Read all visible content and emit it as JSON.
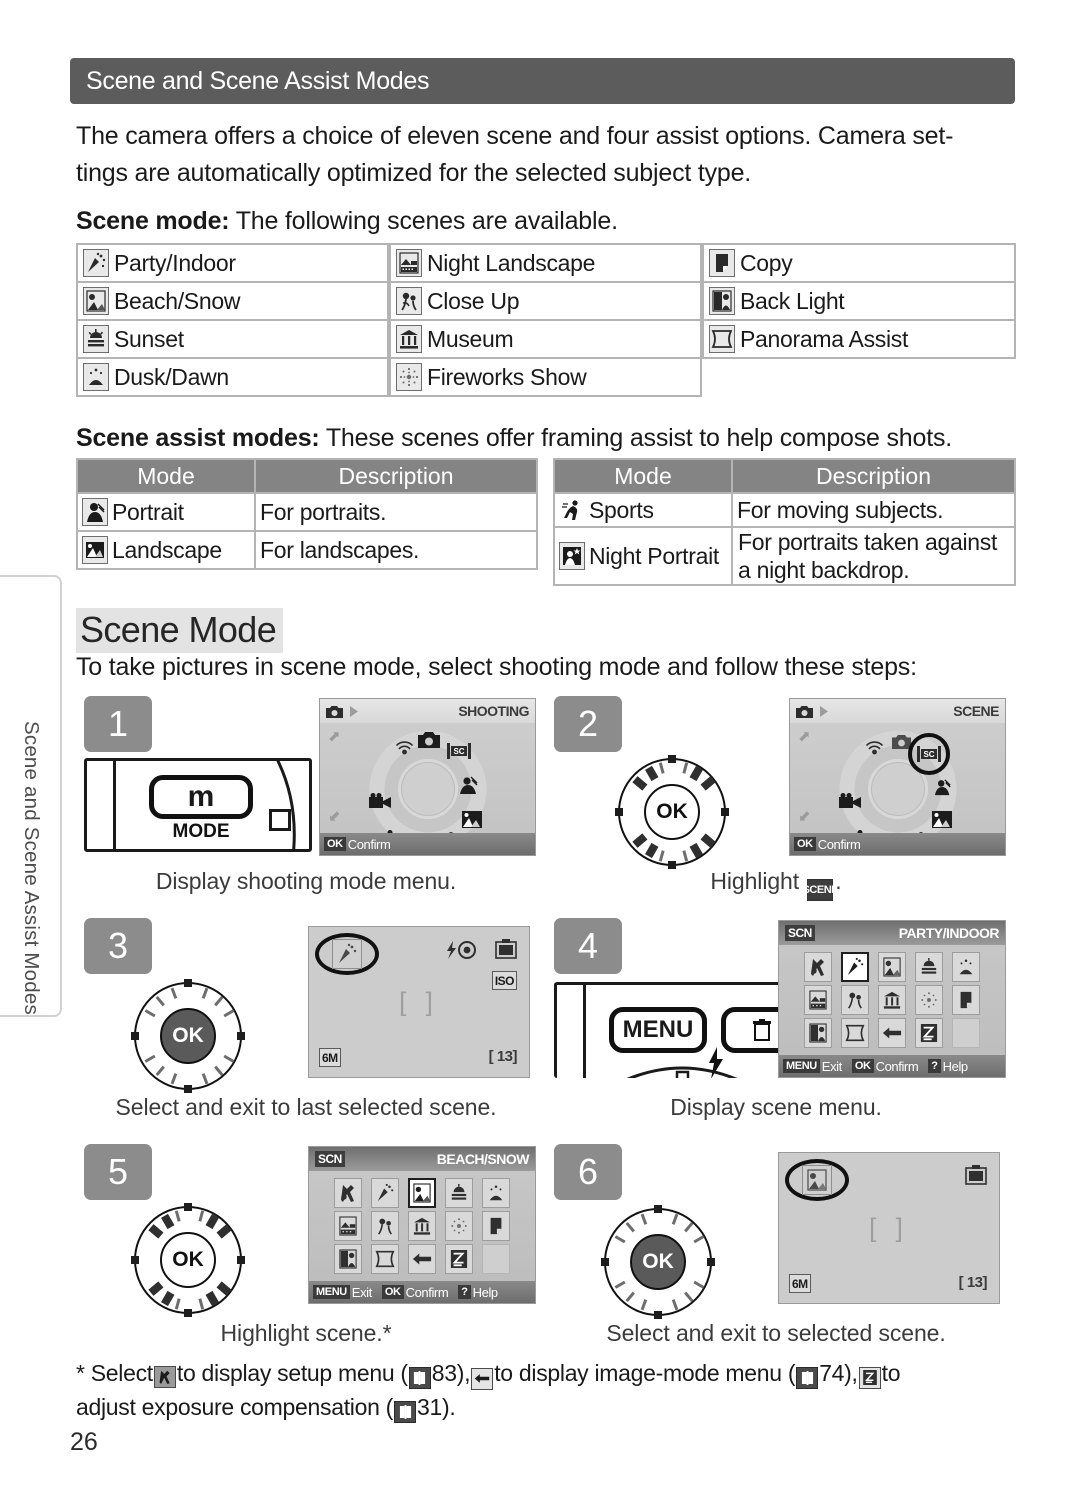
{
  "page": {
    "number": "26",
    "side_tab_label": "Scene and Scene Assist Modes"
  },
  "section": {
    "title": "Scene and Scene Assist Modes",
    "intro_line1": "The camera offers a choice of eleven scene and four assist options.  Camera set-",
    "intro_line2": "tings are automatically optimized for the selected subject type.",
    "scene_mode_lead_bold": "Scene mode:",
    "scene_mode_lead_rest": " The following scenes are available.",
    "assist_lead_bold": "Scene assist modes:",
    "assist_lead_rest": " These scenes offer framing assist to help compose shots."
  },
  "scene_list": {
    "column1": [
      {
        "icon": "party-indoor-icon",
        "label": "Party/Indoor"
      },
      {
        "icon": "beach-snow-icon",
        "label": "Beach/Snow"
      },
      {
        "icon": "sunset-icon",
        "label": "Sunset"
      },
      {
        "icon": "dusk-dawn-icon",
        "label": "Dusk/Dawn"
      }
    ],
    "column2": [
      {
        "icon": "night-landscape-icon",
        "label": "Night Landscape"
      },
      {
        "icon": "close-up-icon",
        "label": "Close Up"
      },
      {
        "icon": "museum-icon",
        "label": "Museum"
      },
      {
        "icon": "fireworks-show-icon",
        "label": "Fireworks Show"
      }
    ],
    "column3": [
      {
        "icon": "copy-icon",
        "label": "Copy"
      },
      {
        "icon": "back-light-icon",
        "label": "Back Light"
      },
      {
        "icon": "panorama-assist-icon",
        "label": "Panorama Assist"
      }
    ]
  },
  "assist_table_left": {
    "headers": {
      "mode": "Mode",
      "description": "Description"
    },
    "rows": [
      {
        "icon": "portrait-icon",
        "mode": "Portrait",
        "description": "For portraits."
      },
      {
        "icon": "landscape-icon",
        "mode": "Landscape",
        "description": "For landscapes."
      }
    ]
  },
  "assist_table_right": {
    "headers": {
      "mode": "Mode",
      "description": "Description"
    },
    "rows": [
      {
        "icon": "sports-icon",
        "mode": "Sports",
        "description": "For moving subjects."
      },
      {
        "icon": "night-portrait-icon",
        "mode": "Night Portrait",
        "description_line1": "For portraits taken against",
        "description_line2": "a night backdrop."
      }
    ]
  },
  "scene_mode_section": {
    "heading": "Scene Mode",
    "lead": "To take pictures in scene mode, select shooting mode and follow these steps:"
  },
  "steps": [
    {
      "number": "1",
      "caption": "Display shooting mode menu.",
      "camera_button_label": "m",
      "camera_button_sublabel": "MODE",
      "lcd": {
        "mode_title": "SHOOTING",
        "confirm_key": "OK",
        "confirm_label": "Confirm",
        "dial_items": [
          "wireless-icon",
          "camera-icon",
          "scene-icon",
          "movie-icon",
          "portrait-assist-icon",
          "voice-icon",
          "landscape-assist-icon",
          "night-portrait-icon",
          "sports-icon"
        ],
        "selected": "camera-icon"
      }
    },
    {
      "number": "2",
      "caption_prefix": "Highlight ",
      "caption_icon": "SCENE",
      "caption_suffix": ".",
      "selector_label": "OK",
      "lcd": {
        "mode_title": "SCENE",
        "confirm_key": "OK",
        "confirm_label": "Confirm",
        "selected": "scene-icon"
      }
    },
    {
      "number": "3",
      "caption": "Select and exit to last selected scene.",
      "selector_label": "OK",
      "lcd": {
        "highlighted_icon": "party-indoor-icon",
        "flash_icon": "red-eye-flash-icon",
        "battery_icon": "battery-icon",
        "iso_label": "ISO",
        "image_size": "6M",
        "shots_remaining": "13"
      }
    },
    {
      "number": "4",
      "caption": "Display scene menu.",
      "camera_button_label": "MENU",
      "lcd": {
        "badge": "SCN",
        "mode_title": "PARTY/INDOOR",
        "exit_key": "MENU",
        "exit_label": "Exit",
        "confirm_key": "OK",
        "confirm_label": "Confirm",
        "help_key": "?",
        "help_label": "Help",
        "grid": [
          "setup-icon",
          "party-indoor-icon",
          "beach-snow-icon",
          "sunset-icon",
          "dusk-dawn-icon",
          "night-landscape-icon",
          "close-up-icon",
          "museum-icon",
          "fireworks-show-icon",
          "copy-icon",
          "back-light-icon",
          "panorama-assist-icon",
          "image-mode-icon",
          "exposure-comp-icon",
          "blank"
        ],
        "selected_index": 1
      }
    },
    {
      "number": "5",
      "caption": "Highlight scene.*",
      "selector_label": "OK",
      "lcd": {
        "badge": "SCN",
        "mode_title": "BEACH/SNOW",
        "exit_key": "MENU",
        "exit_label": "Exit",
        "confirm_key": "OK",
        "confirm_label": "Confirm",
        "help_key": "?",
        "help_label": "Help",
        "grid": [
          "setup-icon",
          "party-indoor-icon",
          "beach-snow-icon",
          "sunset-icon",
          "dusk-dawn-icon",
          "night-landscape-icon",
          "close-up-icon",
          "museum-icon",
          "fireworks-show-icon",
          "copy-icon",
          "back-light-icon",
          "panorama-assist-icon",
          "image-mode-icon",
          "exposure-comp-icon",
          "blank"
        ],
        "selected_index": 2
      }
    },
    {
      "number": "6",
      "caption": "Select and exit to selected scene.",
      "selector_label": "OK",
      "lcd": {
        "highlighted_icon": "beach-snow-icon",
        "battery_icon": "battery-icon",
        "image_size": "6M",
        "shots_remaining": "13"
      }
    }
  ],
  "footnote": {
    "marker": "*",
    "part1": "Select",
    "icon1": "setup-icon",
    "part2": "to display setup menu (",
    "ref_icon1": "book-icon",
    "part3": "83),",
    "icon2": "image-mode-icon",
    "part4": "to display image-mode menu (",
    "ref_icon2": "book-icon",
    "part5": "74),",
    "icon3": "exposure-comp-icon",
    "part6": "to",
    "part7": "adjust exposure compensation (",
    "ref_icon3": "book-icon",
    "part8": "31)."
  },
  "colors": {
    "section_bar": "#5c5c5c",
    "table_header": "#848484",
    "table_border": "#b4b4b4",
    "step_number_bg": "#8c8c8c",
    "heading_highlight": "#e3e3e3"
  }
}
